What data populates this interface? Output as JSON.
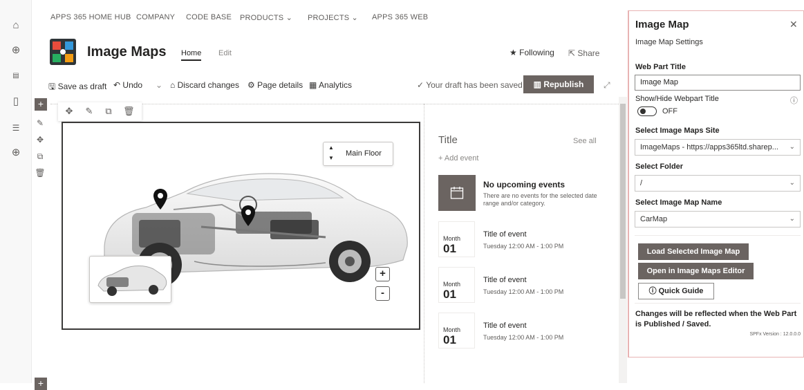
{
  "topnav": {
    "items": [
      "APPS 365 HOME HUB",
      "COMPANY",
      "CODE BASE",
      "PRODUCTS",
      "PROJECTS",
      "APPS 365 WEB"
    ]
  },
  "site": {
    "title": "Image Maps",
    "tabs": {
      "home": "Home",
      "edit": "Edit"
    },
    "following": "Following",
    "share": "Share"
  },
  "commandbar": {
    "save_draft": "Save as draft",
    "undo": "Undo",
    "discard": "Discard changes",
    "page_details": "Page details",
    "analytics": "Analytics",
    "draft_status": "Your draft has been saved",
    "republish": "Republish"
  },
  "imagemap": {
    "floor_label": "Main Floor",
    "zoom_in": "+",
    "zoom_out": "-"
  },
  "events": {
    "title": "Title",
    "see_all": "See all",
    "add_event": "+ Add event",
    "no_events_title": "No upcoming events",
    "no_events_desc": "There are no events for the selected date range and/or category.",
    "items": [
      {
        "month": "Month",
        "day": "01",
        "name": "Title of event",
        "time": "Tuesday 12:00 AM - 1:00 PM"
      },
      {
        "month": "Month",
        "day": "01",
        "name": "Title of event",
        "time": "Tuesday 12:00 AM - 1:00 PM"
      },
      {
        "month": "Month",
        "day": "01",
        "name": "Title of event",
        "time": "Tuesday 12:00 AM - 1:00 PM"
      }
    ]
  },
  "panel": {
    "title": "Image Map",
    "subtitle": "Image Map Settings",
    "web_part_title_label": "Web Part Title",
    "web_part_title_value": "Image Map",
    "show_hide_label": "Show/Hide Webpart Title",
    "toggle_state": "OFF",
    "site_label": "Select Image Maps Site",
    "site_value": "ImageMaps - https://apps365ltd.sharep...",
    "folder_label": "Select Folder",
    "folder_value": "/",
    "map_name_label": "Select Image Map Name",
    "map_name_value": "CarMap",
    "load_button": "Load Selected Image Map",
    "open_editor_button": "Open in Image Maps Editor",
    "quick_guide_button": "Quick Guide",
    "note": "Changes will be reflected when the Web Part is Published / Saved.",
    "version": "SPFx Version : 12.0.0.0"
  },
  "colors": {
    "accent_button": "#6b6461",
    "panel_border": "#e8b3b3"
  }
}
